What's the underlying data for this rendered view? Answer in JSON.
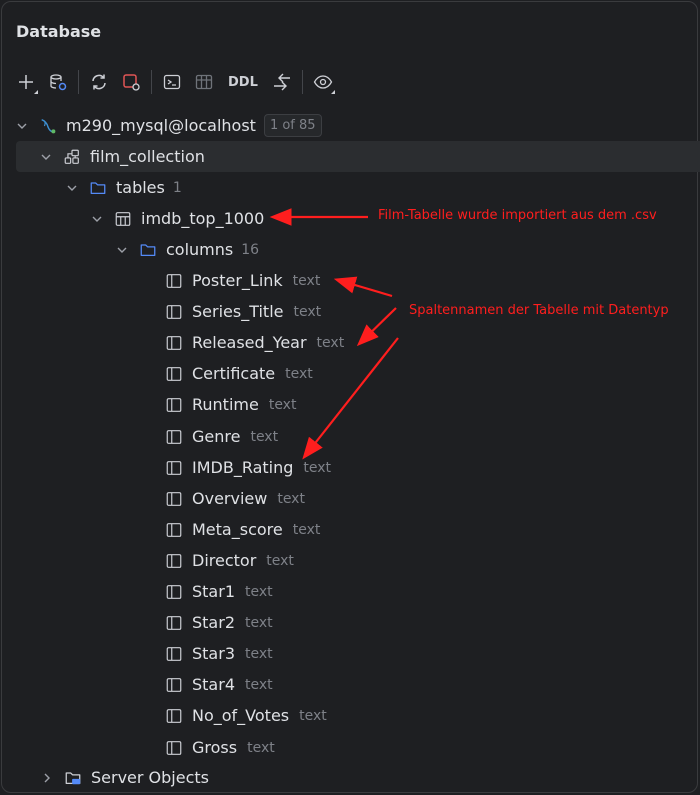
{
  "panel": {
    "title": "Database"
  },
  "toolbar": {
    "items": [
      {
        "icon": "add-icon"
      },
      {
        "icon": "datasource-properties-icon"
      },
      {
        "icon": "refresh-icon"
      },
      {
        "icon": "stop-disconnect-icon"
      },
      {
        "icon": "console-icon"
      },
      {
        "icon": "table-editor-icon"
      },
      {
        "icon": "ddl-label",
        "label": "DDL"
      },
      {
        "icon": "jump-to-source-icon"
      },
      {
        "icon": "view-options-icon"
      }
    ]
  },
  "tree": {
    "connection": {
      "label": "m290_mysql@localhost",
      "badge": "1 of 85"
    },
    "schema": {
      "label": "film_collection"
    },
    "tables_folder": {
      "label": "tables",
      "count": "1"
    },
    "table": {
      "label": "imdb_top_1000"
    },
    "columns_folder": {
      "label": "columns",
      "count": "16"
    },
    "columns": [
      {
        "name": "Poster_Link",
        "type": "text"
      },
      {
        "name": "Series_Title",
        "type": "text"
      },
      {
        "name": "Released_Year",
        "type": "text"
      },
      {
        "name": "Certificate",
        "type": "text"
      },
      {
        "name": "Runtime",
        "type": "text"
      },
      {
        "name": "Genre",
        "type": "text"
      },
      {
        "name": "IMDB_Rating",
        "type": "text"
      },
      {
        "name": "Overview",
        "type": "text"
      },
      {
        "name": "Meta_score",
        "type": "text"
      },
      {
        "name": "Director",
        "type": "text"
      },
      {
        "name": "Star1",
        "type": "text"
      },
      {
        "name": "Star2",
        "type": "text"
      },
      {
        "name": "Star3",
        "type": "text"
      },
      {
        "name": "Star4",
        "type": "text"
      },
      {
        "name": "No_of_Votes",
        "type": "text"
      },
      {
        "name": "Gross",
        "type": "text"
      }
    ],
    "server_objects": {
      "label": "Server Objects"
    }
  },
  "annotations": {
    "table_note": "Film-Tabelle wurde importiert aus dem .csv",
    "columns_note": "Spaltennamen der Tabelle mit Datentyp",
    "color": "#ff1e1e"
  },
  "colors": {
    "background": "#1e1f22",
    "selection": "#2b2d30",
    "folder": "#548af7",
    "mysql_logo": "#3d8fd1",
    "connected_dot": "#5fb865",
    "stop": "#e05555"
  }
}
